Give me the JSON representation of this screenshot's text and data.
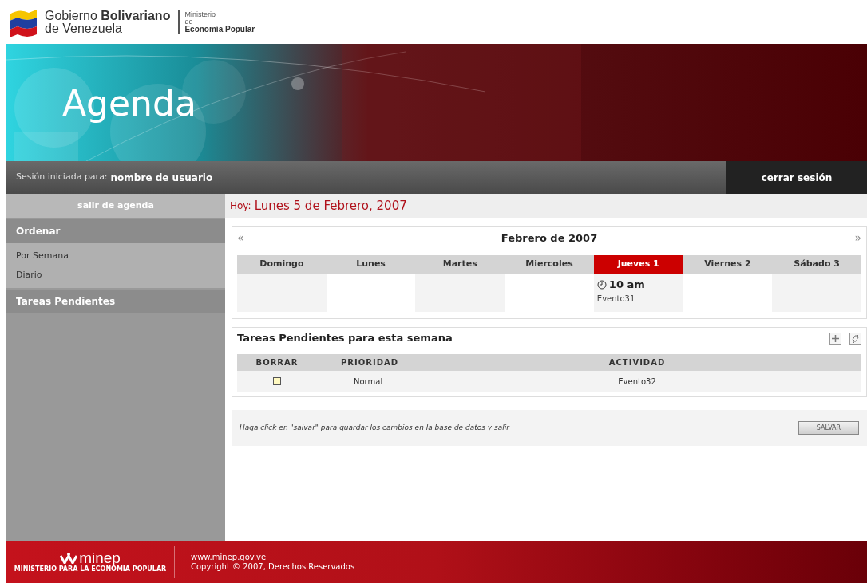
{
  "header": {
    "logo_line1": "Gobierno **Bolivariano**",
    "logo_line2": "de Venezuela",
    "ministry_line1": "Ministerio",
    "ministry_line2": "de",
    "ministry_line3": "Economía Popular"
  },
  "banner": {
    "kind": "picture",
    "title": "Agenda"
  },
  "session_bar": {
    "label": "Sesión iniciada para:",
    "user": "nombre de usuario",
    "logout": "cerrar sesión"
  },
  "sidebar": {
    "exit": "salir de agenda",
    "sections": [
      {
        "title": "Ordenar",
        "items": [
          "Por Semana",
          "Diario"
        ]
      },
      {
        "title": "Tareas Pendientes"
      }
    ]
  },
  "today": {
    "label": "Hoy:",
    "date": "Lunes 5 de Febrero, 2007"
  },
  "calendar": {
    "prev": "«",
    "title": "Febrero de 2007",
    "next": "»",
    "days": [
      {
        "label": "Domingo",
        "selected": false
      },
      {
        "label": "Lunes",
        "selected": false
      },
      {
        "label": "Martes",
        "selected": false
      },
      {
        "label": "Miercoles",
        "selected": false
      },
      {
        "label": "Jueves 1",
        "selected": true,
        "events": [
          {
            "time": "10 am",
            "name": "Evento31"
          }
        ]
      },
      {
        "label": "Viernes 2",
        "selected": false
      },
      {
        "label": "Sábado 3",
        "selected": false
      }
    ]
  },
  "tasks": {
    "title": "Tareas Pendientes para esta semana",
    "columns": [
      "BORRAR",
      "PRIORIDAD",
      "ACTIVIDAD"
    ],
    "rows": [
      {
        "checked": false,
        "priority": "Normal",
        "activity": "Evento32"
      }
    ]
  },
  "save": {
    "hint": "Haga click en \"salvar\" para guardar los cambios en la base de datos y salir",
    "button": "SALVAR"
  },
  "footer": {
    "logo": "minep",
    "logo_sub": "MINISTERIO PARA LA ECONOMIA POPULAR",
    "url": "www.minep.gov.ve",
    "copyright": "Copyright © 2007, Derechos Reservados"
  }
}
